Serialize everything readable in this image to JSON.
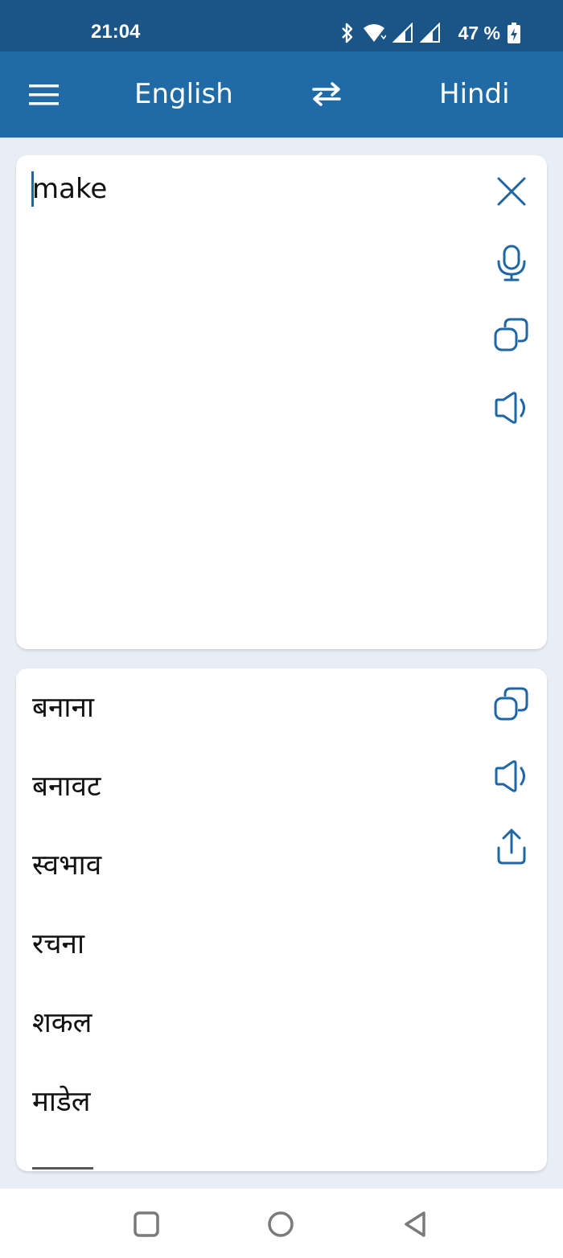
{
  "status_bar": {
    "time": "21:04",
    "battery_text": "47 %",
    "icons": [
      "bluetooth-icon",
      "wifi-icon",
      "signal-icon",
      "signal-icon",
      "battery-charging-icon"
    ]
  },
  "app_bar": {
    "menu_icon": "hamburger-menu-icon",
    "source_language": "English",
    "swap_icon": "swap-arrows-icon",
    "target_language": "Hindi"
  },
  "input_card": {
    "text": "make",
    "actions": [
      "close-icon",
      "microphone-icon",
      "copy-icon",
      "speaker-icon"
    ]
  },
  "output_card": {
    "results": [
      "बनाना",
      "बनावट",
      "स्वभाव",
      "रचना",
      "शकल",
      "माडेल"
    ],
    "actions": [
      "copy-icon",
      "speaker-icon",
      "share-icon"
    ]
  },
  "nav_bar": {
    "buttons": [
      "recents-square-icon",
      "home-circle-icon",
      "back-triangle-icon"
    ]
  },
  "colors": {
    "status_bar": "#1b5587",
    "app_bar": "#206aa5",
    "accent_icon": "#1f66a6",
    "background": "#e8eef6"
  }
}
